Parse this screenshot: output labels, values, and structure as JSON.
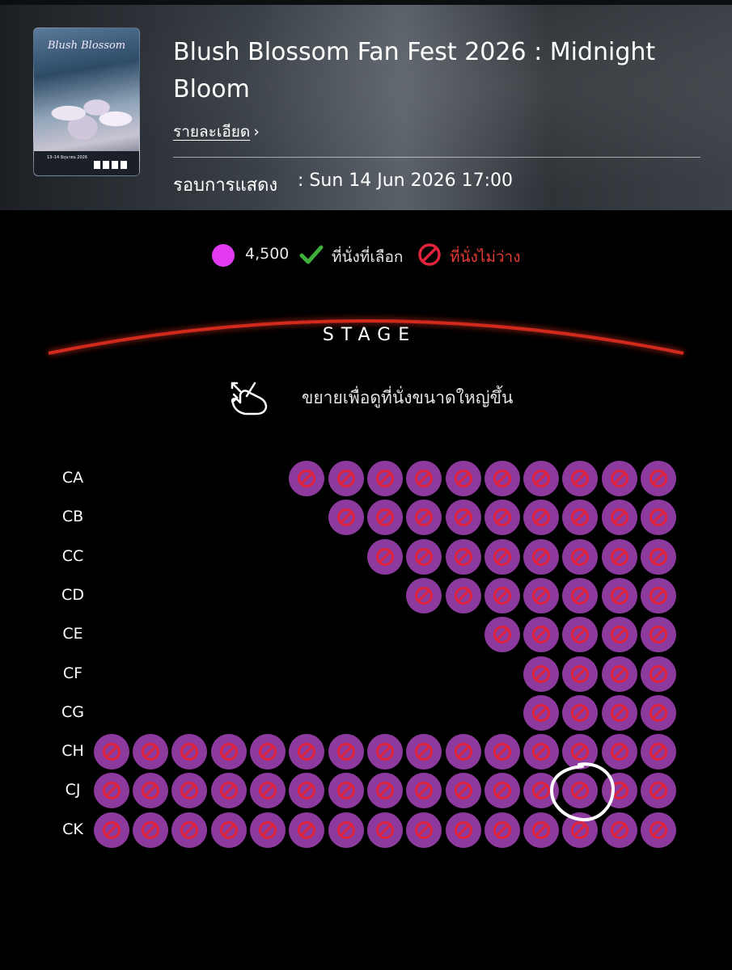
{
  "event": {
    "title": "Blush Blossom Fan Fest 2026 : Midnight Bloom",
    "details_link": "รายละเอียด",
    "showtime_label": "รอบการแสดง",
    "showtime_value": ": Sun 14 Jun 2026 17:00",
    "poster": {
      "title": "Blush Blossom",
      "date": "13–14 มิถุนายน 2026"
    }
  },
  "legend": {
    "price": "4,500",
    "selected_label": "ที่นั่งที่เลือก",
    "unavailable_label": "ที่นั่งไม่ว่าง"
  },
  "stage": {
    "label": "STAGE"
  },
  "zoom_hint": "ขยายเพื่อดูที่นั่งขนาดใหญ่ขึ้น",
  "colors": {
    "seat_fill": "#8d3a9e",
    "unavailable_icon": "#e0233a",
    "price_dot": "#e23bf2",
    "selected_check": "#3fae3a",
    "stage_arc": "#d12a1f"
  },
  "seat_map": {
    "all_seats_status": "unavailable",
    "rows": [
      {
        "label": "CA",
        "seats": 10
      },
      {
        "label": "CB",
        "seats": 9
      },
      {
        "label": "CC",
        "seats": 8
      },
      {
        "label": "CD",
        "seats": 7
      },
      {
        "label": "CE",
        "seats": 5
      },
      {
        "label": "CF",
        "seats": 4
      },
      {
        "label": "CG",
        "seats": 4
      },
      {
        "label": "CH",
        "seats": 15
      },
      {
        "label": "CJ",
        "seats": 15
      },
      {
        "label": "CK",
        "seats": 15
      }
    ],
    "circled": {
      "row": "CJ",
      "seat_from_right": 3
    }
  }
}
